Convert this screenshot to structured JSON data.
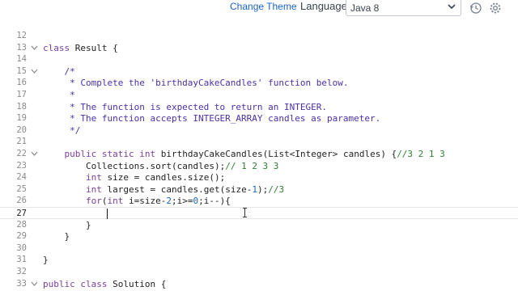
{
  "toolbar": {
    "change_theme": "Change Theme",
    "language_label": "Language",
    "language_value": "Java 8",
    "icons": [
      "chevron-down-icon",
      "history-icon",
      "settings-icon"
    ]
  },
  "editor": {
    "lines": [
      {
        "n": "12",
        "text": ""
      },
      {
        "n": "13",
        "text": "class Result {",
        "fold": true
      },
      {
        "n": "14",
        "text": ""
      },
      {
        "n": "15",
        "text": "    /*",
        "fold": true
      },
      {
        "n": "16",
        "text": "     * Complete the 'birthdayCakeCandles' function below."
      },
      {
        "n": "17",
        "text": "     *"
      },
      {
        "n": "18",
        "text": "     * The function is expected to return an INTEGER."
      },
      {
        "n": "19",
        "text": "     * The function accepts INTEGER_ARRAY candles as parameter."
      },
      {
        "n": "20",
        "text": "     */"
      },
      {
        "n": "21",
        "text": ""
      },
      {
        "n": "22",
        "text": "    public static int birthdayCakeCandles(List<Integer> candles) {//3 2 1 3",
        "fold": true
      },
      {
        "n": "23",
        "text": "        Collections.sort(candles);// 1 2 3 3"
      },
      {
        "n": "24",
        "text": "        int size = candles.size();"
      },
      {
        "n": "25",
        "text": "        int largest = candles.get(size-1);//3"
      },
      {
        "n": "26",
        "text": "        for(int i=size-2;i>=0;i--){"
      },
      {
        "n": "27",
        "text": "            ",
        "active": true
      },
      {
        "n": "28",
        "text": "        }"
      },
      {
        "n": "29",
        "text": "    }"
      },
      {
        "n": "30",
        "text": ""
      },
      {
        "n": "31",
        "text": "}"
      },
      {
        "n": "32",
        "text": ""
      },
      {
        "n": "33",
        "text": "public class Solution {",
        "fold": true
      }
    ]
  }
}
